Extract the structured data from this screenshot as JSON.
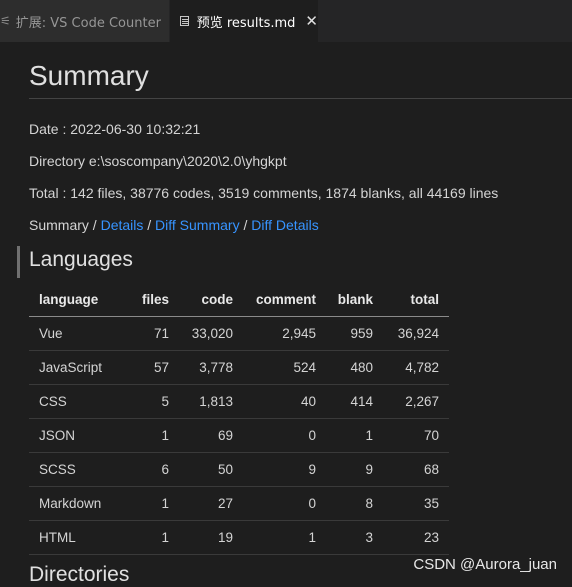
{
  "tabs": {
    "inactive_icon": "extension-icon",
    "inactive_label": "扩展: VS Code Counter",
    "active_label": "预览 results.md",
    "close_glyph": "✕"
  },
  "doc": {
    "title": "Summary",
    "date": "Date : 2022-06-30 10:32:21",
    "directory": "Directory e:\\soscompany\\2020\\2.0\\yhgkpt",
    "total": "Total : 142 files, 38776 codes, 3519 comments, 1874 blanks, all 44169 lines",
    "nav": {
      "summary": "Summary",
      "sep": " / ",
      "details": "Details",
      "diff_summary": "Diff Summary",
      "diff_details": "Diff Details"
    },
    "languages_heading": "Languages",
    "table": {
      "headers": [
        "language",
        "files",
        "code",
        "comment",
        "blank",
        "total"
      ],
      "rows": [
        [
          "Vue",
          "71",
          "33,020",
          "2,945",
          "959",
          "36,924"
        ],
        [
          "JavaScript",
          "57",
          "3,778",
          "524",
          "480",
          "4,782"
        ],
        [
          "CSS",
          "5",
          "1,813",
          "40",
          "414",
          "2,267"
        ],
        [
          "JSON",
          "1",
          "69",
          "0",
          "1",
          "70"
        ],
        [
          "SCSS",
          "6",
          "50",
          "9",
          "9",
          "68"
        ],
        [
          "Markdown",
          "1",
          "27",
          "0",
          "8",
          "35"
        ],
        [
          "HTML",
          "1",
          "19",
          "1",
          "3",
          "23"
        ]
      ]
    },
    "directories_heading": "Directories"
  },
  "watermark": "CSDN @Aurora_juan",
  "colors": {
    "link": "#3794ff",
    "background": "#1e1e1e"
  }
}
